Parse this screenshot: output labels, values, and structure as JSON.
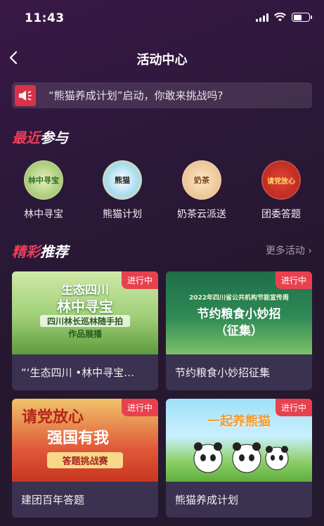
{
  "status": {
    "time": "11:43"
  },
  "nav": {
    "title": "活动中心"
  },
  "notice": {
    "text": "“熊猫养成计划”启动，你敢来挑战吗?"
  },
  "recent": {
    "title_hi": "最近",
    "title_rest": "参与",
    "items": [
      {
        "label": "林中寻宝",
        "art": "林中寻宝"
      },
      {
        "label": "熊猫计划",
        "art": "熊猫"
      },
      {
        "label": "奶茶云派送",
        "art": "奶茶"
      },
      {
        "label": "团委答题",
        "art": "请党放心"
      }
    ]
  },
  "featured": {
    "title_hi": "精彩",
    "title_rest": "推荐",
    "more": "更多活动 ›",
    "cards": [
      {
        "badge": "进行中",
        "caption": "“‘生态四川 •林中寻宝…",
        "art_title": "生态四川",
        "art_sub": "林中寻宝",
        "art_line": "四川林长巡林随手拍",
        "art_line2": "作品展播"
      },
      {
        "badge": "进行中",
        "caption": "节约粮食小妙招征集",
        "art_title": "2022年四川省公共机构节能宣传周",
        "art_sub": "节约粮食小妙招",
        "art_line": "（征集）",
        "art_line2": ""
      },
      {
        "badge": "进行中",
        "caption": "建团百年答题",
        "art_title": "请党放心",
        "art_sub": "强国有我",
        "art_line": "答题挑战赛",
        "art_line2": ""
      },
      {
        "badge": "进行中",
        "caption": "熊猫养成计划",
        "art_title": "一起养熊猫",
        "art_sub": "",
        "art_line": "",
        "art_line2": ""
      }
    ]
  },
  "colors": {
    "accent": "#ee3d59",
    "badge": "#e8414e"
  }
}
